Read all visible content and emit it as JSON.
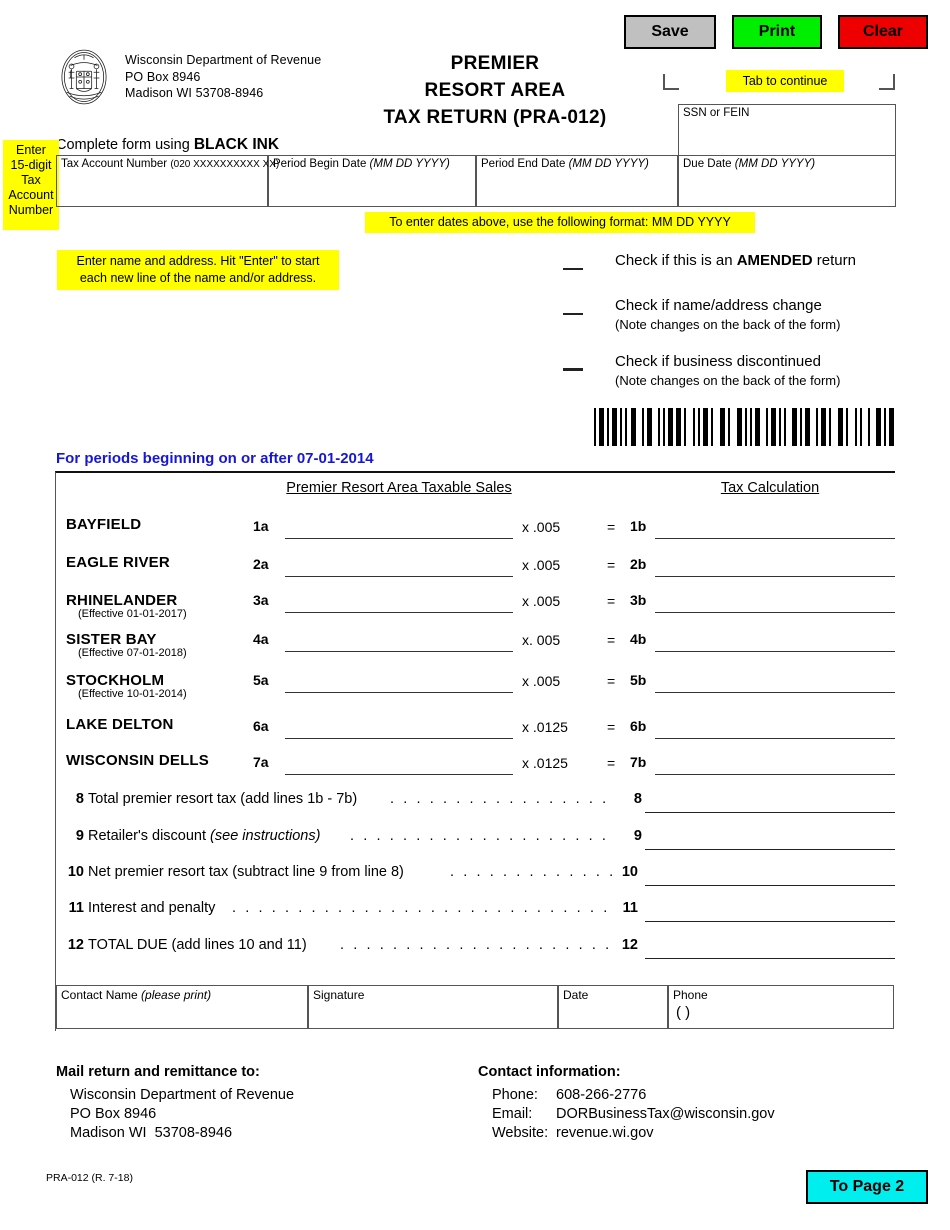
{
  "toolbar": {
    "save_label": "Save",
    "print_label": "Print",
    "clear_label": "Clear",
    "save_color": "#c0c0c0",
    "print_color": "#00ee00",
    "clear_color": "#ee0000"
  },
  "agency": {
    "name": "Wisconsin Department of Revenue",
    "po_box": "PO Box 8946",
    "city_state_zip": "Madison WI  53708-8946",
    "seal_name": "wisconsin-state-seal"
  },
  "title": {
    "line1": "PREMIER",
    "line2": "RESORT AREA",
    "line3": "TAX RETURN  (PRA-012)"
  },
  "hints": {
    "tab_to_continue": "Tab to continue",
    "account_number": "Enter 15-digit Tax Account Number",
    "date_format": "To enter dates above, use the following format: MM DD YYYY",
    "name_address_line1": "Enter name and address. Hit \"Enter\" to start",
    "name_address_line2": "each new line of the name and/or address.",
    "highlight_color": "#ffff00"
  },
  "instructions": {
    "black_ink_prefix": "Complete form using ",
    "black_ink_emphasis": "BLACK INK"
  },
  "header_fields": {
    "ssn_or_fein": "SSN or FEIN",
    "tax_account_number": "Tax Account Number",
    "tax_account_number_hint": "(020 XXXXXXXXXX XX)",
    "period_begin_date": "Period Begin Date",
    "period_begin_format": "(MM DD YYYY)",
    "period_end_date": "Period End Date",
    "period_end_format": "(MM DD YYYY)",
    "due_date": "Due Date",
    "due_date_format": "(MM DD YYYY)"
  },
  "checkboxes": [
    {
      "label_prefix": "Check if this is an ",
      "label_bold": "AMENDED",
      "label_suffix": " return",
      "sub": ""
    },
    {
      "label_prefix": "Check if name/address change",
      "label_bold": "",
      "label_suffix": "",
      "sub": "(Note changes on the back of the form)"
    },
    {
      "label_prefix": "Check if business discontinued",
      "label_bold": "",
      "label_suffix": "",
      "sub": "(Note changes on the back of the form)"
    }
  ],
  "periods_note": "For periods beginning on or after 07-01-2014",
  "table": {
    "col_head_sales": "Premier Resort Area Taxable Sales",
    "col_head_calc": "Tax Calculation",
    "equals": "=",
    "rows": [
      {
        "city": "BAYFIELD",
        "effective": "",
        "line_a": "1a",
        "rate": "x .005",
        "line_b": "1b"
      },
      {
        "city": "EAGLE RIVER",
        "effective": "",
        "line_a": "2a",
        "rate": "x .005",
        "line_b": "2b"
      },
      {
        "city": "RHINELANDER",
        "effective": "(Effective 01-01-2017)",
        "line_a": "3a",
        "rate": "x .005",
        "line_b": "3b"
      },
      {
        "city": "SISTER BAY",
        "effective": "(Effective 07-01-2018)",
        "line_a": "4a",
        "rate": "x.  005",
        "line_b": "4b"
      },
      {
        "city": "STOCKHOLM",
        "effective": "(Effective 10-01-2014)",
        "line_a": "5a",
        "rate": "x .005",
        "line_b": "5b"
      },
      {
        "city": "LAKE DELTON",
        "effective": "",
        "line_a": "6a",
        "rate": "x .0125",
        "line_b": "6b"
      },
      {
        "city": "WISCONSIN DELLS",
        "effective": "",
        "line_a": "7a",
        "rate": "x .0125",
        "line_b": "7b"
      }
    ],
    "lines": [
      {
        "no": "8",
        "text": "Total premier resort tax (add lines 1b - 7b)",
        "italic": ""
      },
      {
        "no": "9",
        "text": "Retailer's discount ",
        "italic": "(see instructions)"
      },
      {
        "no": "10",
        "text": "Net premier resort tax (subtract line 9 from line 8)",
        "italic": ""
      },
      {
        "no": "11",
        "text": "Interest and penalty",
        "italic": ""
      },
      {
        "no": "12",
        "text": "TOTAL DUE (add lines 10 and 11)",
        "italic": ""
      }
    ]
  },
  "signature_row": {
    "contact_name": "Contact Name ",
    "contact_name_italic": "(please print)",
    "signature": "Signature",
    "date": "Date",
    "phone": "Phone",
    "phone_parens": "(        )"
  },
  "footer": {
    "mail_head": "Mail return and remittance to:",
    "mail_line1": "Wisconsin Department of Revenue",
    "mail_line2": "PO Box 8946",
    "mail_line3": "Madison WI  53708-8946",
    "contact_head": "Contact information:",
    "phone_label": "Phone:",
    "phone_value": "608-266-2776",
    "email_label": "Email:",
    "email_value": "DORBusinessTax@wisconsin.gov",
    "website_label": "Website:",
    "website_value": "revenue.wi.gov",
    "form_id": "PRA-012 (R. 7-18)",
    "page2_label": "To Page 2",
    "page2_color": "#00eeee"
  }
}
